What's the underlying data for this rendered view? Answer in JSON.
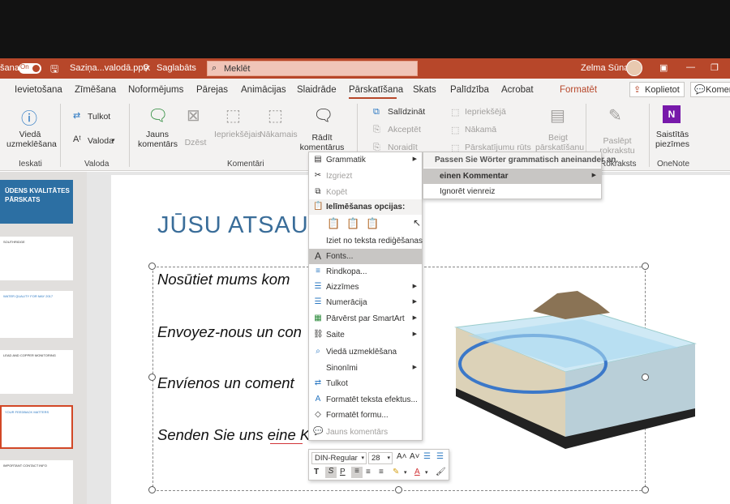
{
  "titlebar": {
    "left_fragment": "šana",
    "autosave_on": "On",
    "filename": "Saziņa...valodā.pptx",
    "saved_status": "Saglabāts",
    "search_placeholder": "Meklēt",
    "user_name": "Zelma Sūna"
  },
  "tabs": [
    "Ievietošana",
    "Zīmēšana",
    "Noformējums",
    "Pārejas",
    "Animācijas",
    "Slaidrāde",
    "Pārskatīšana",
    "Skats",
    "Palīdzība",
    "Acrobat",
    "Formatēt"
  ],
  "tab_actions": {
    "share": "Koplietot",
    "comments": "Komen"
  },
  "ribbon": {
    "smart_lookup": [
      "Viedā",
      "uzmeklēšana"
    ],
    "translate": "Tulkot",
    "language": "Valoda",
    "new_comment": [
      "Jauns",
      "komentārs"
    ],
    "delete": "Dzēst",
    "previous": "Iepriekšējais",
    "next": "Nākamais",
    "show_comments": [
      "Rādīt",
      "komentārus"
    ],
    "compare": "Salīdzināt",
    "accept": "Akceptēt",
    "reject": "Noraidīt",
    "prev_change": "Iepriekšējā",
    "next_change": "Nākamā",
    "reviewing_pane": "Pārskatījumu rūts",
    "end_review": [
      "Beigt",
      "pārskatīšanu"
    ],
    "hide_ink": [
      "Paslēpt",
      "rokrakstu"
    ],
    "linked_notes": [
      "Saistītās",
      "piezīmes"
    ],
    "groups": [
      "Ieskati",
      "Valoda",
      "Komentāri",
      "Rokraksts",
      "OneNote"
    ]
  },
  "thumbnails": [
    {
      "title": "ŪDENS KVALITĀTES PĀRSKATS"
    },
    {
      "title": "SOUTHRIDGE"
    },
    {
      "title": "WATER QUALITY FOR MAY 2017"
    },
    {
      "title": "LEAD AND COPPER MONITORING"
    },
    {
      "title": "YOUR FEEDBACK MATTERS"
    },
    {
      "title": "IMPORTANT CONTACT INFO"
    }
  ],
  "slide": {
    "title": "JŪSU ATSAUK",
    "lines": [
      "Nosūtiet mums kom",
      "Envoyez-nous un con",
      "Envíenos un coment",
      "Senden Sie uns eine Kommentar"
    ]
  },
  "context_menu": {
    "items": [
      {
        "label": "Grammatik",
        "icon": "▤",
        "submenu": true
      },
      {
        "label": "Izgriezt",
        "icon": "✂",
        "disabled": true
      },
      {
        "label": "Kopēt",
        "icon": "⧉",
        "disabled": true
      },
      {
        "label": "Ielīmēšanas opcijas:",
        "icon": "📋",
        "bold": true
      },
      {
        "label": "Iziet no teksta rediģēšanas"
      },
      {
        "label": "Fonts...",
        "icon": "A",
        "highlight": true
      },
      {
        "label": "Rindkopa...",
        "icon": "≡"
      },
      {
        "label": "Aizzīmes",
        "icon": "☰",
        "submenu": true
      },
      {
        "label": "Numerācija",
        "icon": "☰",
        "submenu": true
      },
      {
        "label": "Pārvērst par SmartArt",
        "icon": "▦",
        "submenu": true
      },
      {
        "label": "Saite",
        "icon": "⛓",
        "submenu": true
      },
      {
        "label": "Viedā uzmeklēšana",
        "icon": "⌕"
      },
      {
        "label": "Sinonīmi",
        "submenu": true
      },
      {
        "label": "Tulkot",
        "icon": "⇄"
      },
      {
        "label": "Formatēt teksta efektus...",
        "icon": "A"
      },
      {
        "label": "Formatēt formu...",
        "icon": "◇"
      },
      {
        "label": "Jauns komentārs",
        "icon": "💬",
        "disabled": true
      }
    ]
  },
  "submenu": {
    "header": "Passen Sie Wörter grammatisch aneinander an.",
    "items": [
      "einen Kommentar",
      "Ignorēt vienreiz"
    ]
  },
  "mini_toolbar": {
    "font": "DIN-Regular",
    "size": "28"
  },
  "colors": {
    "accent": "#b7472a",
    "highlight": "#c8c6c4",
    "title_blue": "#3a6d99"
  }
}
